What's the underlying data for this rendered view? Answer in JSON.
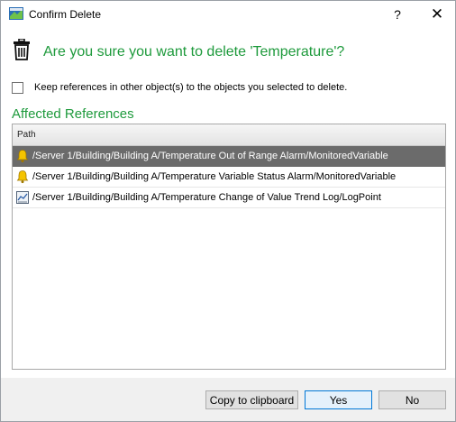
{
  "window": {
    "title": "Confirm Delete",
    "help_label": "?",
    "close_label": "✕"
  },
  "dialog": {
    "question": "Are you sure you want to delete 'Temperature'?",
    "keep_references_label": "Keep references in other object(s) to the objects you selected to delete.",
    "keep_references_checked": false,
    "section_title": "Affected References"
  },
  "table": {
    "column_header": "Path",
    "rows": [
      {
        "icon": "alarm-bell-icon",
        "path": "/Server 1/Building/Building A/Temperature Out of Range Alarm/MonitoredVariable",
        "selected": true
      },
      {
        "icon": "alarm-bell-icon",
        "path": "/Server 1/Building/Building A/Temperature Variable Status Alarm/MonitoredVariable",
        "selected": false
      },
      {
        "icon": "trend-log-icon",
        "path": "/Server 1/Building/Building A/Temperature Change of Value Trend Log/LogPoint",
        "selected": false
      }
    ]
  },
  "buttons": {
    "copy_label": "Copy to clipboard",
    "yes_label": "Yes",
    "no_label": "No"
  },
  "colors": {
    "accent_green": "#1e9a3c",
    "selection": "#6b6b6b",
    "default_button_border": "#0078d7"
  }
}
